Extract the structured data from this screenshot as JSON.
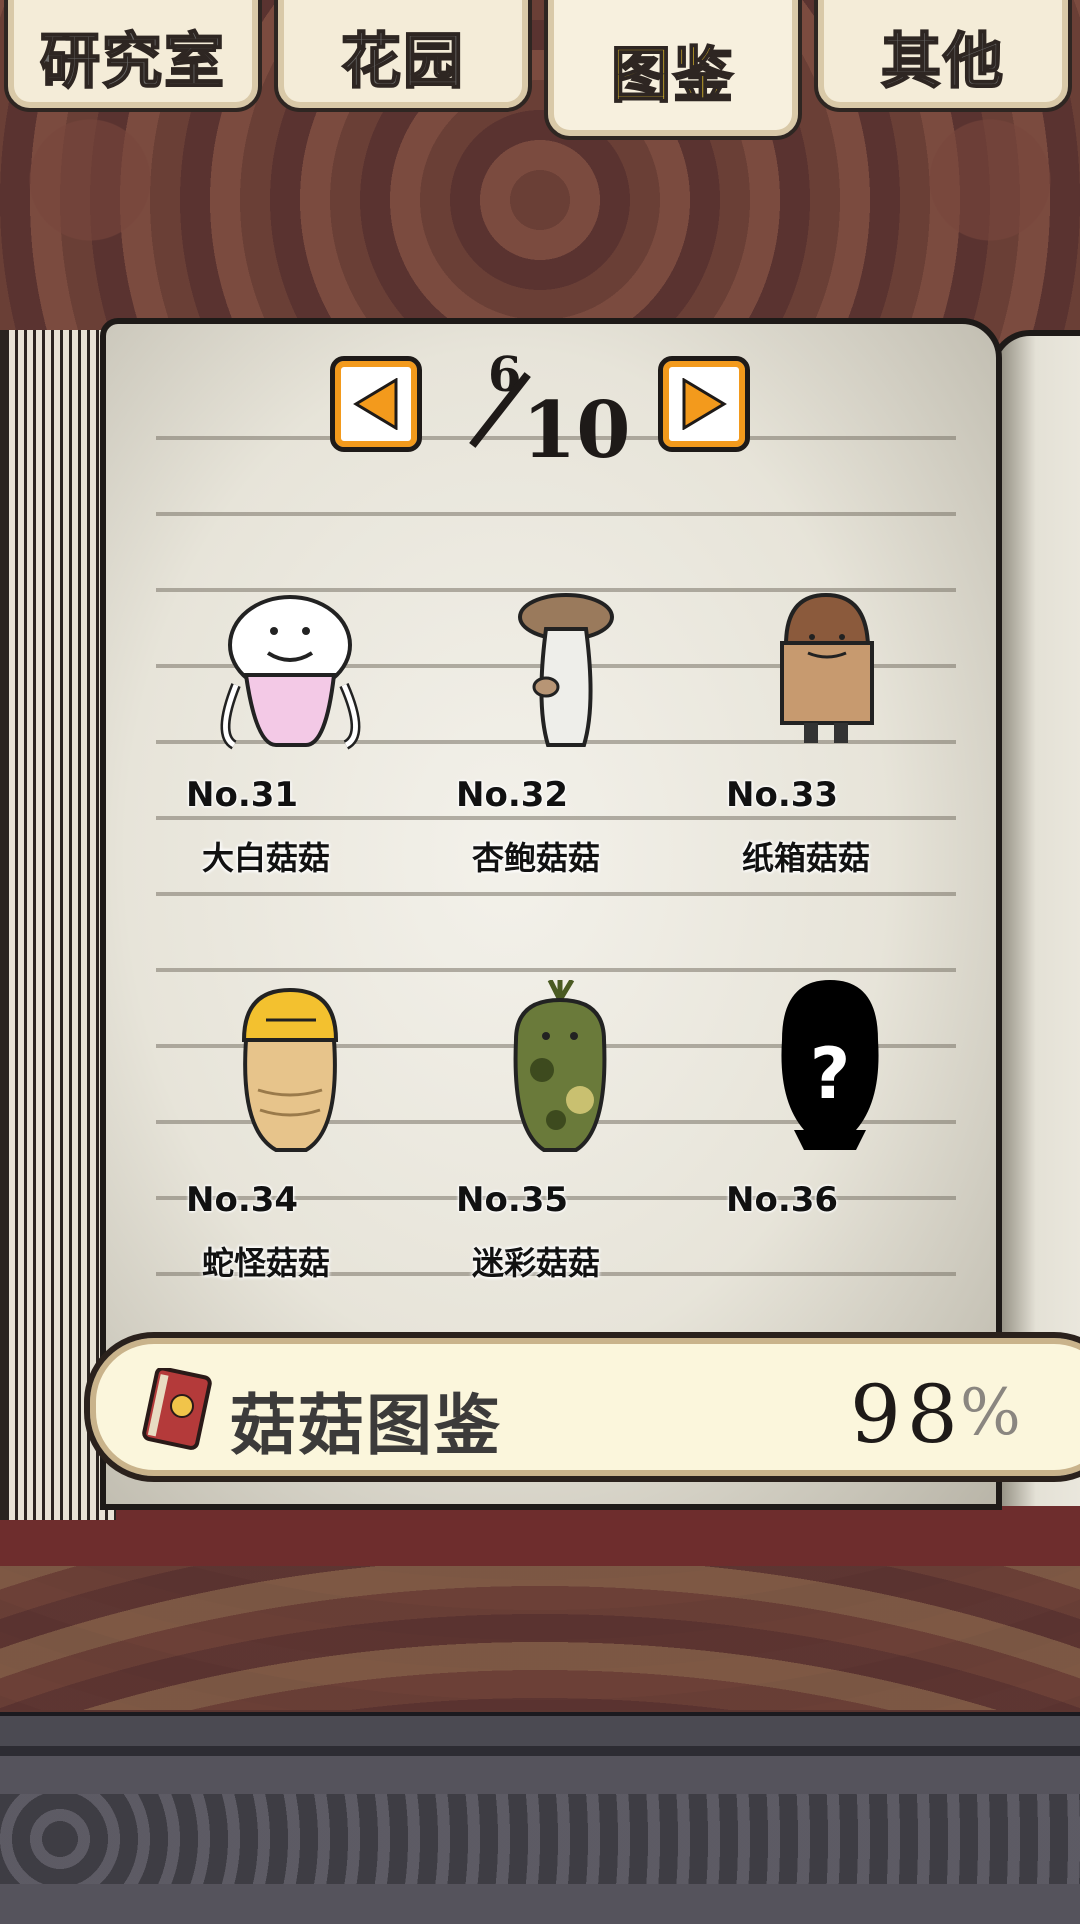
{
  "tabs": [
    {
      "label": "研究室",
      "active": false
    },
    {
      "label": "花园",
      "active": false
    },
    {
      "label": "图鉴",
      "active": true
    },
    {
      "label": "其他",
      "active": false
    }
  ],
  "pager": {
    "current": "6",
    "total": "10"
  },
  "entries": [
    {
      "number": "No.31",
      "name": "大白菇菇",
      "icon": "white-mushroom-icon"
    },
    {
      "number": "No.32",
      "name": "杏鲍菇菇",
      "icon": "king-oyster-mushroom-icon"
    },
    {
      "number": "No.33",
      "name": "纸箱菇菇",
      "icon": "cardboard-mushroom-icon"
    },
    {
      "number": "No.34",
      "name": "蛇怪菇菇",
      "icon": "snake-mushroom-icon"
    },
    {
      "number": "No.35",
      "name": "迷彩菇菇",
      "icon": "camo-mushroom-icon"
    },
    {
      "number": "No.36",
      "name": "",
      "icon": "unknown-silhouette-icon"
    }
  ],
  "collection": {
    "title": "菇菇图鉴",
    "percent": "98",
    "percent_sign": "%"
  },
  "colors": {
    "active_tab_text": "#ffd72a",
    "pager_accent": "#f39a1c",
    "progress_bg": "#fbf6dc"
  }
}
